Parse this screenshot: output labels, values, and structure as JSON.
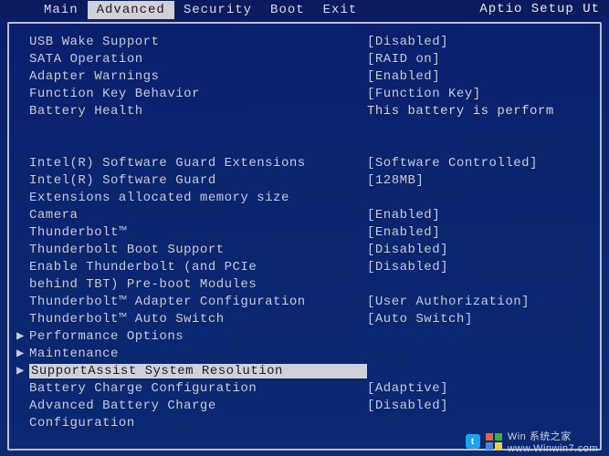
{
  "header": {
    "title_right": "Aptio Setup Ut",
    "tabs": [
      "Main",
      "Advanced",
      "Security",
      "Boot",
      "Exit"
    ],
    "active_tab_index": 1
  },
  "rows": [
    {
      "label": "USB Wake Support",
      "value": "[Disabled]"
    },
    {
      "label": "SATA Operation",
      "value": "[RAID on]"
    },
    {
      "label": "Adapter Warnings",
      "value": "[Enabled]"
    },
    {
      "label": "Function Key Behavior",
      "value": "[Function Key]"
    },
    {
      "label": "Battery Health",
      "value": "This battery is perform",
      "info": true
    },
    {
      "blank": true
    },
    {
      "blank": true
    },
    {
      "label": "Intel(R) Software Guard Extensions",
      "value": "[Software Controlled]"
    },
    {
      "label": "Intel(R) Software Guard",
      "value": "[128MB]"
    },
    {
      "label": "Extensions allocated memory size",
      "value": "",
      "cont": true
    },
    {
      "label": "Camera",
      "value": "[Enabled]"
    },
    {
      "label": "Thunderbolt™",
      "value": "[Enabled]"
    },
    {
      "label": "Thunderbolt Boot Support",
      "value": "[Disabled]"
    },
    {
      "label": "Enable Thunderbolt (and PCIe",
      "value": "[Disabled]"
    },
    {
      "label": "behind TBT) Pre-boot Modules",
      "value": "",
      "cont": true
    },
    {
      "label": "Thunderbolt™ Adapter Configuration",
      "value": "[User Authorization]"
    },
    {
      "label": "Thunderbolt™ Auto Switch",
      "value": "[Auto Switch]"
    },
    {
      "label": "Performance Options",
      "value": "",
      "submenu": true
    },
    {
      "label": "Maintenance",
      "value": "",
      "submenu": true
    },
    {
      "label": "SupportAssist System Resolution",
      "value": "",
      "submenu": true,
      "selected": true
    },
    {
      "label": "Battery Charge Configuration",
      "value": "[Adaptive]"
    },
    {
      "label": "Advanced Battery Charge",
      "value": "[Disabled]"
    },
    {
      "label": "Configuration",
      "value": "",
      "cont": true
    }
  ],
  "watermark": {
    "text1": "Win 系统之家",
    "text2": "www.Winwin7.com"
  }
}
